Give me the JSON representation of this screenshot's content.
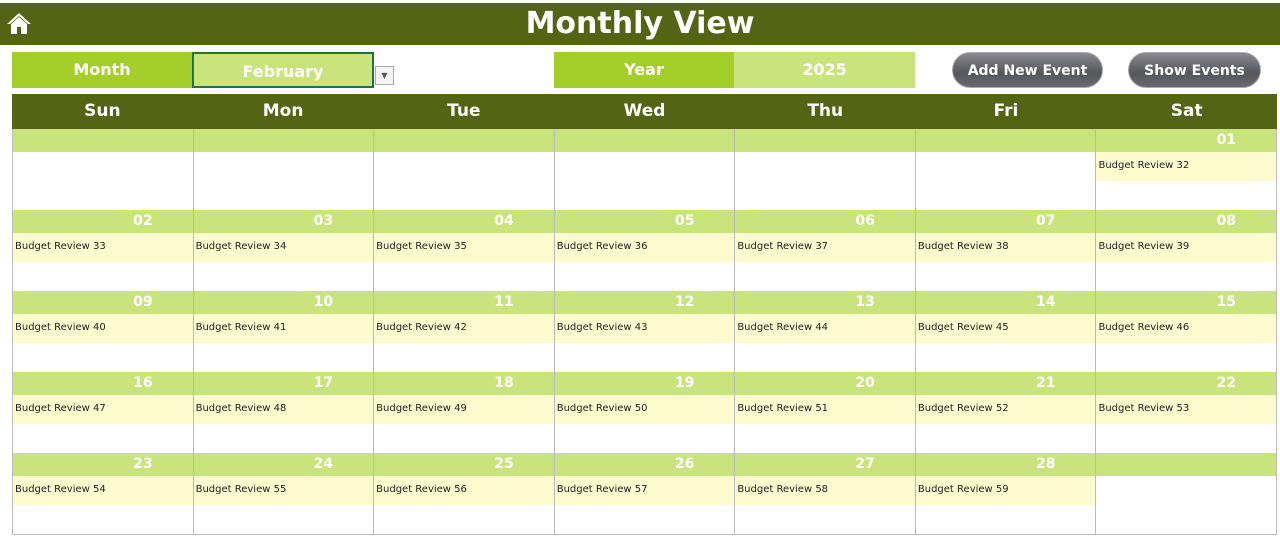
{
  "title": "Monthly View",
  "controls": {
    "month_label": "Month",
    "month_value": "February",
    "year_label": "Year",
    "year_value": "2025",
    "add_event": "Add New Event",
    "show_events": "Show Events"
  },
  "days": [
    "Sun",
    "Mon",
    "Tue",
    "Wed",
    "Thu",
    "Fri",
    "Sat"
  ],
  "weeks": [
    [
      {
        "d": "",
        "e": ""
      },
      {
        "d": "",
        "e": ""
      },
      {
        "d": "",
        "e": ""
      },
      {
        "d": "",
        "e": ""
      },
      {
        "d": "",
        "e": ""
      },
      {
        "d": "",
        "e": ""
      },
      {
        "d": "01",
        "e": "Budget Review 32"
      }
    ],
    [
      {
        "d": "02",
        "e": "Budget Review 33"
      },
      {
        "d": "03",
        "e": "Budget Review 34"
      },
      {
        "d": "04",
        "e": "Budget Review 35"
      },
      {
        "d": "05",
        "e": "Budget Review 36"
      },
      {
        "d": "06",
        "e": "Budget Review 37"
      },
      {
        "d": "07",
        "e": "Budget Review 38"
      },
      {
        "d": "08",
        "e": "Budget Review 39"
      }
    ],
    [
      {
        "d": "09",
        "e": "Budget Review 40"
      },
      {
        "d": "10",
        "e": "Budget Review 41"
      },
      {
        "d": "11",
        "e": "Budget Review 42"
      },
      {
        "d": "12",
        "e": "Budget Review 43"
      },
      {
        "d": "13",
        "e": "Budget Review 44"
      },
      {
        "d": "14",
        "e": "Budget Review 45"
      },
      {
        "d": "15",
        "e": "Budget Review 46"
      }
    ],
    [
      {
        "d": "16",
        "e": "Budget Review 47"
      },
      {
        "d": "17",
        "e": "Budget Review 48"
      },
      {
        "d": "18",
        "e": "Budget Review 49"
      },
      {
        "d": "19",
        "e": "Budget Review 50"
      },
      {
        "d": "20",
        "e": "Budget Review 51"
      },
      {
        "d": "21",
        "e": "Budget Review 52"
      },
      {
        "d": "22",
        "e": "Budget Review 53"
      }
    ],
    [
      {
        "d": "23",
        "e": "Budget Review 54"
      },
      {
        "d": "24",
        "e": "Budget Review 55"
      },
      {
        "d": "25",
        "e": "Budget Review 56"
      },
      {
        "d": "26",
        "e": "Budget Review 57"
      },
      {
        "d": "27",
        "e": "Budget Review 58"
      },
      {
        "d": "28",
        "e": "Budget Review 59"
      },
      {
        "d": "",
        "e": ""
      }
    ]
  ]
}
